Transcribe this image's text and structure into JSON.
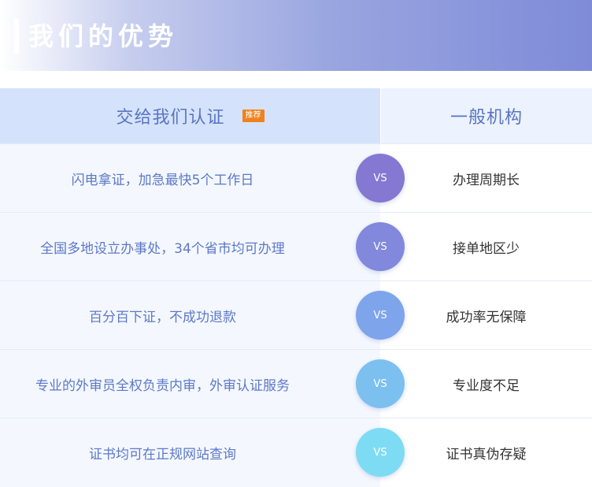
{
  "banner": {
    "title": "我们的优势"
  },
  "table": {
    "left_header": "交给我们认证",
    "left_tag": "推荐",
    "right_header": "一般机构",
    "vs_label": "VS",
    "rows": [
      {
        "left": "闪电拿证，加急最快5个工作日",
        "right": "办理周期长",
        "vs_color": "#8478d2"
      },
      {
        "left": "全国多地设立办事处，34个省市均可办理",
        "right": "接单地区少",
        "vs_color": "#8288dc"
      },
      {
        "left": "百分百下证，不成功退款",
        "right": "成功率无保障",
        "vs_color": "#7ea4ec"
      },
      {
        "left": "专业的外审员全权负责内审，外审认证服务",
        "right": "专业度不足",
        "vs_color": "#7cc0f0"
      },
      {
        "left": "证书均可在正规网站查询",
        "right": "证书真伪存疑",
        "vs_color": "#7ddcf4"
      }
    ]
  }
}
